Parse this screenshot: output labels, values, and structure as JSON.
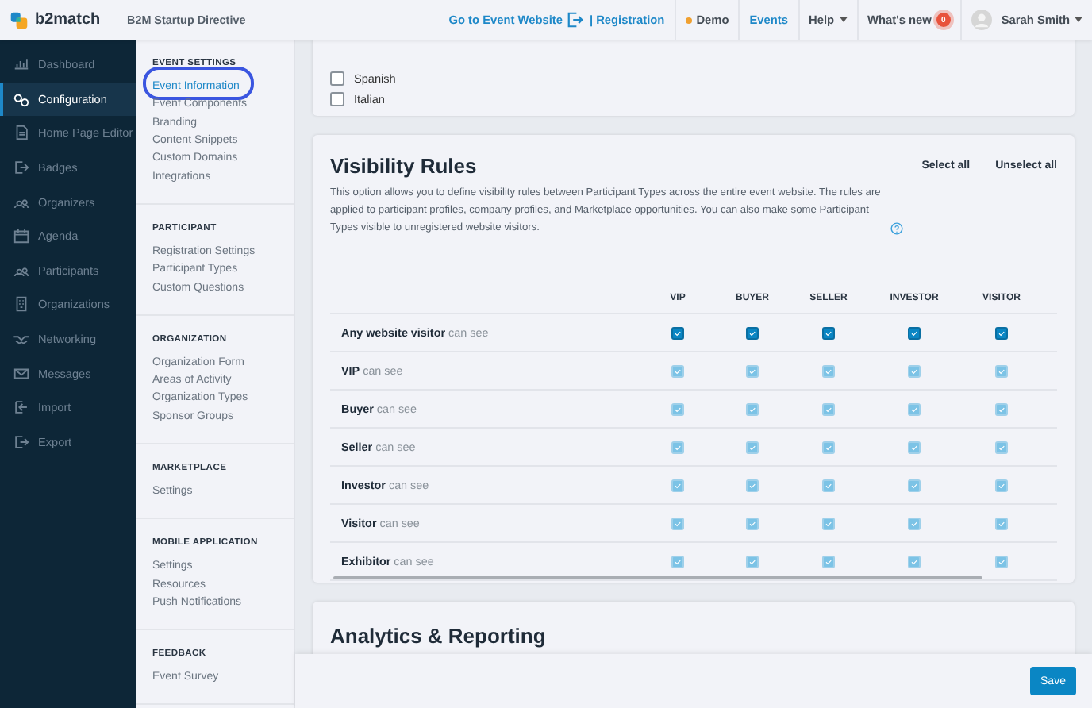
{
  "header": {
    "logo": "b2match",
    "event_title": "B2M Startup Directive",
    "website_link": "Go to Event Website",
    "registration_link": "| Registration",
    "demo": "Demo",
    "events": "Events",
    "help": "Help",
    "whats_new": "What's new",
    "whats_new_badge": "0",
    "user": "Sarah Smith"
  },
  "sidebar": {
    "items": [
      {
        "label": "Dashboard",
        "selected": false
      },
      {
        "label": "Configuration",
        "selected": true
      },
      {
        "label": "Home Page Editor",
        "selected": false
      },
      {
        "label": "Badges",
        "selected": false
      },
      {
        "label": "Organizers",
        "selected": false
      },
      {
        "label": "Agenda",
        "selected": false
      },
      {
        "label": "Participants",
        "selected": false
      },
      {
        "label": "Organizations",
        "selected": false
      },
      {
        "label": "Networking",
        "selected": false
      },
      {
        "label": "Messages",
        "selected": false
      },
      {
        "label": "Import",
        "selected": false
      },
      {
        "label": "Export",
        "selected": false
      }
    ]
  },
  "settings_nav": [
    {
      "heading": "EVENT SETTINGS",
      "items": [
        {
          "label": "Event Information",
          "selected": true,
          "circled": true
        },
        {
          "label": "Event Components",
          "selected": false,
          "circled": false
        },
        {
          "label": "Branding",
          "selected": false,
          "circled": false
        },
        {
          "label": "Content Snippets",
          "selected": false,
          "circled": false
        },
        {
          "label": "Custom Domains",
          "selected": false,
          "circled": false
        },
        {
          "label": "Integrations",
          "selected": false,
          "circled": false
        }
      ]
    },
    {
      "heading": "PARTICIPANT",
      "items": [
        {
          "label": "Registration Settings",
          "selected": false,
          "circled": false
        },
        {
          "label": "Participant Types",
          "selected": false,
          "circled": false
        },
        {
          "label": "Custom Questions",
          "selected": false,
          "circled": false
        }
      ]
    },
    {
      "heading": "ORGANIZATION",
      "items": [
        {
          "label": "Organization Form",
          "selected": false,
          "circled": false
        },
        {
          "label": "Areas of Activity",
          "selected": false,
          "circled": false
        },
        {
          "label": "Organization Types",
          "selected": false,
          "circled": false
        },
        {
          "label": "Sponsor Groups",
          "selected": false,
          "circled": false
        }
      ]
    },
    {
      "heading": "MARKETPLACE",
      "items": [
        {
          "label": "Settings",
          "selected": false,
          "circled": false
        }
      ]
    },
    {
      "heading": "MOBILE APPLICATION",
      "items": [
        {
          "label": "Settings",
          "selected": false,
          "circled": false
        },
        {
          "label": "Resources",
          "selected": false,
          "circled": false
        },
        {
          "label": "Push Notifications",
          "selected": false,
          "circled": false
        }
      ]
    },
    {
      "heading": "FEEDBACK",
      "items": [
        {
          "label": "Event Survey",
          "selected": false,
          "circled": false
        }
      ]
    }
  ],
  "languages": [
    {
      "label": "Spanish",
      "checked": false
    },
    {
      "label": "Italian",
      "checked": false
    }
  ],
  "visibility": {
    "title": "Visibility Rules",
    "description": "This option allows you to define visibility rules between Participant Types across the entire event website. The rules are applied to participant profiles, company profiles, and Marketplace opportunities. You can also make some Participant Types visible to unregistered website visitors.",
    "select_all": "Select all",
    "unselect_all": "Unselect all",
    "columns": [
      "VIP",
      "BUYER",
      "SELLER",
      "INVESTOR",
      "VISITOR"
    ],
    "rows": [
      {
        "name": "Any website visitor",
        "suffix": "can see",
        "disabled": false,
        "checks": [
          true,
          true,
          true,
          true,
          true
        ]
      },
      {
        "name": "VIP",
        "suffix": "can see",
        "disabled": true,
        "checks": [
          true,
          true,
          true,
          true,
          true
        ]
      },
      {
        "name": "Buyer",
        "suffix": "can see",
        "disabled": true,
        "checks": [
          true,
          true,
          true,
          true,
          true
        ]
      },
      {
        "name": "Seller",
        "suffix": "can see",
        "disabled": true,
        "checks": [
          true,
          true,
          true,
          true,
          true
        ]
      },
      {
        "name": "Investor",
        "suffix": "can see",
        "disabled": true,
        "checks": [
          true,
          true,
          true,
          true,
          true
        ]
      },
      {
        "name": "Visitor",
        "suffix": "can see",
        "disabled": true,
        "checks": [
          true,
          true,
          true,
          true,
          true
        ]
      },
      {
        "name": "Exhibitor",
        "suffix": "can see",
        "disabled": true,
        "checks": [
          true,
          true,
          true,
          true,
          true
        ]
      }
    ]
  },
  "analytics": {
    "title": "Analytics & Reporting"
  },
  "save_button": "Save"
}
